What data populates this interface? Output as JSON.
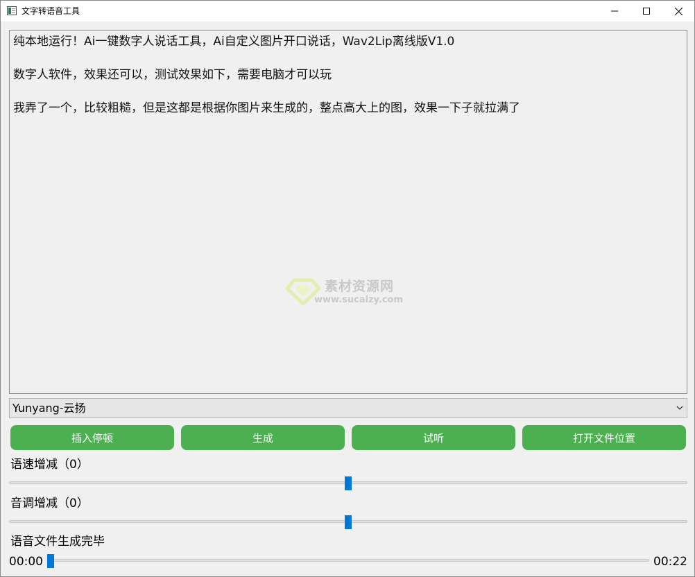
{
  "window": {
    "title": "文字转语音工具"
  },
  "editor": {
    "lines": [
      "纯本地运行！Ai一键数字人说话工具，Ai自定义图片开口说话，Wav2Lip离线版V1.0",
      "数字人软件，效果还可以，测试效果如下，需要电脑才可以玩",
      "我弄了一个，比较粗糙，但是这都是根据你图片来生成的，整点高大上的图，效果一下子就拉满了"
    ]
  },
  "watermark": {
    "name": "素材资源网",
    "url": "www.sucaizy.com"
  },
  "voice_select": {
    "selected": "Yunyang-云扬"
  },
  "buttons": {
    "insert_pause": "插入停顿",
    "generate": "生成",
    "preview": "试听",
    "open_location": "打开文件位置"
  },
  "speed": {
    "label": "语速增减（0）",
    "value": 0,
    "min": -100,
    "max": 100
  },
  "pitch": {
    "label": "音调增减（0）",
    "value": 0,
    "min": -100,
    "max": 100
  },
  "status": {
    "text": "语音文件生成完毕"
  },
  "playback": {
    "current": "00:00",
    "total": "00:22",
    "progress": 0
  },
  "colors": {
    "button_green": "#4caf50",
    "slider_handle": "#0078d7"
  }
}
